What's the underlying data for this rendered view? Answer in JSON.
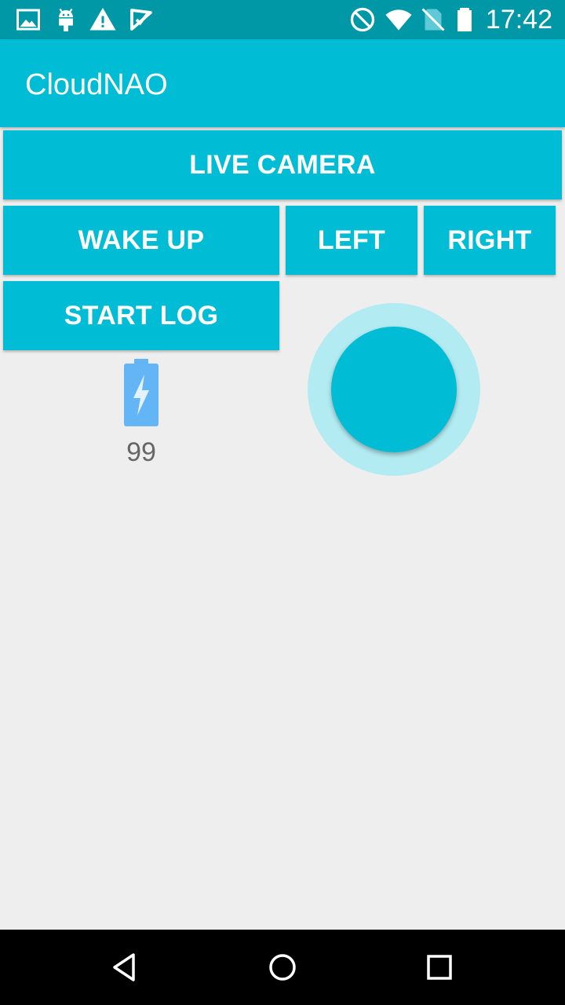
{
  "status_bar": {
    "time": "17:42",
    "left_icons": [
      "image-icon",
      "android-icon",
      "warning-icon",
      "check-icon"
    ],
    "right_icons": [
      "do-not-disturb-icon",
      "wifi-icon",
      "no-sim-icon",
      "battery-icon"
    ]
  },
  "app_bar": {
    "title": "CloudNAO"
  },
  "buttons": {
    "live_camera": "LIVE CAMERA",
    "wake_up": "WAKE UP",
    "left": "LEFT",
    "right": "RIGHT",
    "start_log": "START LOG"
  },
  "battery": {
    "level": "99",
    "icon": "battery-charging-icon",
    "color": "#64b5f6"
  },
  "theme": {
    "primary": "#00bcd4",
    "primary_dark": "#0097a7",
    "accent_light": "#b2ebf2",
    "background": "#eeeeee"
  },
  "nav_bar": {
    "icons": [
      "back-icon",
      "home-icon",
      "recents-icon"
    ]
  }
}
